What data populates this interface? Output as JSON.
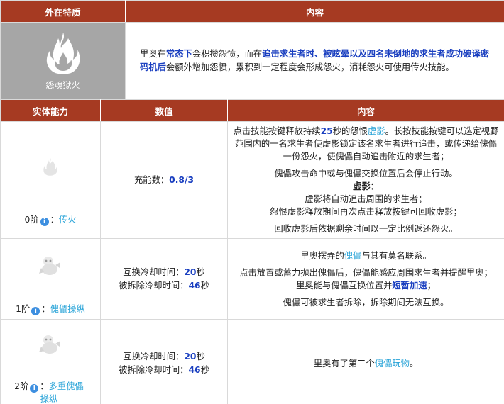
{
  "table1": {
    "headers": [
      "外在特质",
      "内容"
    ],
    "trait_label": "怨魂狱火",
    "description": {
      "p1": "里奥在",
      "b1": "常态下",
      "p2": "会积攒怨愤，而在",
      "b2": "追击求生者时、被眩晕以及四名未倒地的求生者成功破译密码机后",
      "p3": "会额外增加怨愤，累积到一定程度会形成怨火，消耗怨火可使用传火技能。"
    }
  },
  "table2": {
    "headers": [
      "实体能力",
      "数值",
      "内容"
    ],
    "rows": [
      {
        "tier": "0阶",
        "name": "传火",
        "value_line1_label": "充能数：",
        "value_line1_num": "0.8/3",
        "content": {
          "l1a": "点击技能按键释放持续",
          "l1n": "25",
          "l1b": "秒的怨恨",
          "l1link": "虚影",
          "l1c": "。长按技能按键可以选定视野范围内的一名求生者使虚影锁定该名求生者进行追击，或传递给傀儡一份怨火，使傀儡自动追击附近的求生者；",
          "l2": "傀儡攻击命中或与傀儡交换位置后会停止行动。",
          "l3title": "虚影：",
          "l4": "虚影将自动追击周围的求生者；",
          "l5": "怨恨虚影释放期间再次点击释放按键可回收虚影；",
          "l6": "回收虚影后依据剩余时间以一定比例返还怨火。"
        }
      },
      {
        "tier": "1阶",
        "name": "傀儡操纵",
        "value_line1_label": "互换冷却时间：",
        "value_line1_num": "20",
        "value_line1_unit": "秒",
        "value_line2_label": "被拆除冷却时间：",
        "value_line2_num": "46",
        "value_line2_unit": "秒",
        "content": {
          "l1a": "里奥摆弄的",
          "l1link": "傀儡",
          "l1b": "与其有莫名联系。",
          "l2": "点击放置或蓄力抛出傀儡后，傀儡能感应周围求生者并提醒里奥；",
          "l3a": "里奥能与傀儡互换位置并",
          "l3b": "短暂加速",
          "l3c": "；",
          "l4": "傀儡可被求生者拆除，拆除期间无法互换。"
        }
      },
      {
        "tier": "2阶",
        "name": "多重傀儡操纵",
        "value_line1_label": "互换冷却时间：",
        "value_line1_num": "20",
        "value_line1_unit": "秒",
        "value_line2_label": "被拆除冷却时间：",
        "value_line2_num": "46",
        "value_line2_unit": "秒",
        "content": {
          "l1a": "里奥有了第二个",
          "l1link": "傀儡玩物",
          "l1b": "。"
        }
      }
    ]
  },
  "colors": {
    "header_bg": "#a63a22",
    "link": "#2aa4d8",
    "bold_blue": "#1a3fc0",
    "icon_cell_bg": "#a6a6a6"
  },
  "icons": [
    "flame-icon",
    "small-flame-icon",
    "puppet-icon",
    "info-icon"
  ]
}
